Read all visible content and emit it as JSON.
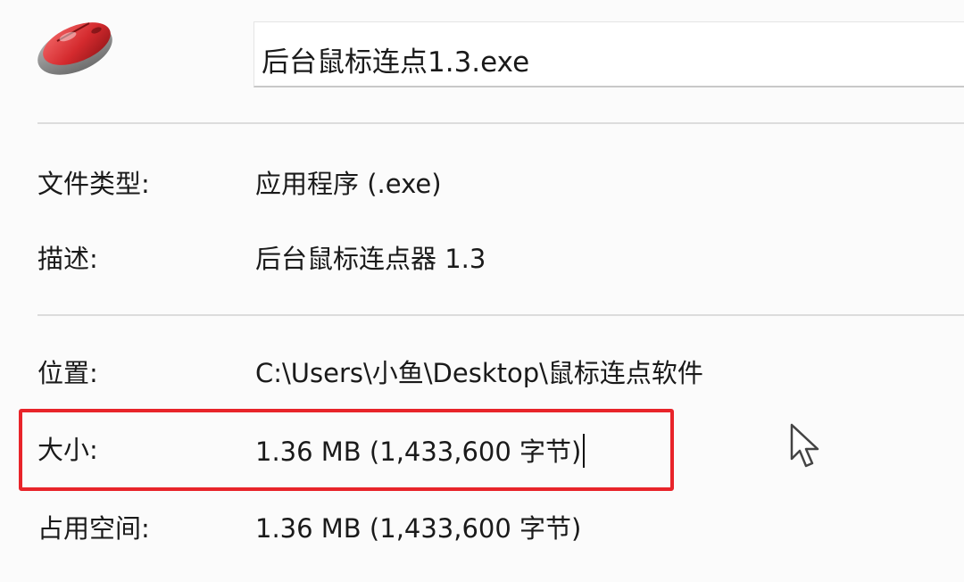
{
  "header": {
    "icon": "mouse-icon",
    "filename": "后台鼠标连点1.3.exe"
  },
  "properties": {
    "file_type": {
      "label": "文件类型:",
      "value": "应用程序 (.exe)"
    },
    "description": {
      "label": "描述:",
      "value": "后台鼠标连点器 1.3"
    },
    "location": {
      "label": "位置:",
      "value": "C:\\Users\\小鱼\\Desktop\\鼠标连点软件"
    },
    "size": {
      "label": "大小:",
      "value": "1.36 MB (1,433,600 字节)"
    },
    "size_on_disk": {
      "label": "占用空间:",
      "value": "1.36 MB (1,433,600 字节)"
    }
  },
  "colors": {
    "highlight": "#e8242a",
    "icon_red": "#d42a2e"
  },
  "overlay": {
    "pointer": "arrow-cursor-icon"
  }
}
